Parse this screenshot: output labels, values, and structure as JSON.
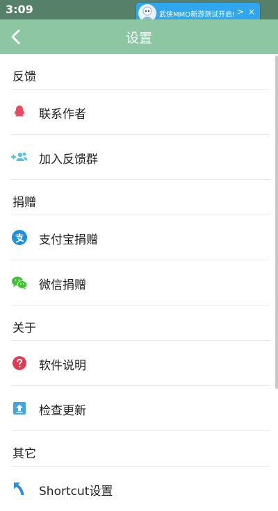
{
  "status_bar": {
    "time": "3:09"
  },
  "notification": {
    "text": "武侠MMO新游测试开启!",
    "chevron": ">",
    "close": "×"
  },
  "appbar": {
    "title": "设置"
  },
  "sections": [
    {
      "title": "反馈",
      "items": [
        {
          "label": "联系作者",
          "icon": "qq-icon",
          "color": "#e84a5f"
        },
        {
          "label": "加入反馈群",
          "icon": "group-add-icon",
          "color": "#4fc3e6"
        }
      ]
    },
    {
      "title": "捐赠",
      "items": [
        {
          "label": "支付宝捐赠",
          "icon": "alipay-icon",
          "color": "#1a91d9"
        },
        {
          "label": "微信捐赠",
          "icon": "wechat-icon",
          "color": "#3cc42f"
        }
      ]
    },
    {
      "title": "关于",
      "items": [
        {
          "label": "软件说明",
          "icon": "help-icon",
          "color": "#e23a52"
        },
        {
          "label": "检查更新",
          "icon": "update-icon",
          "color": "#3ea6e0"
        }
      ]
    },
    {
      "title": "其它",
      "items": [
        {
          "label": "Shortcut设置",
          "icon": "shortcut-icon",
          "color": "#2a8fd6"
        }
      ]
    }
  ]
}
